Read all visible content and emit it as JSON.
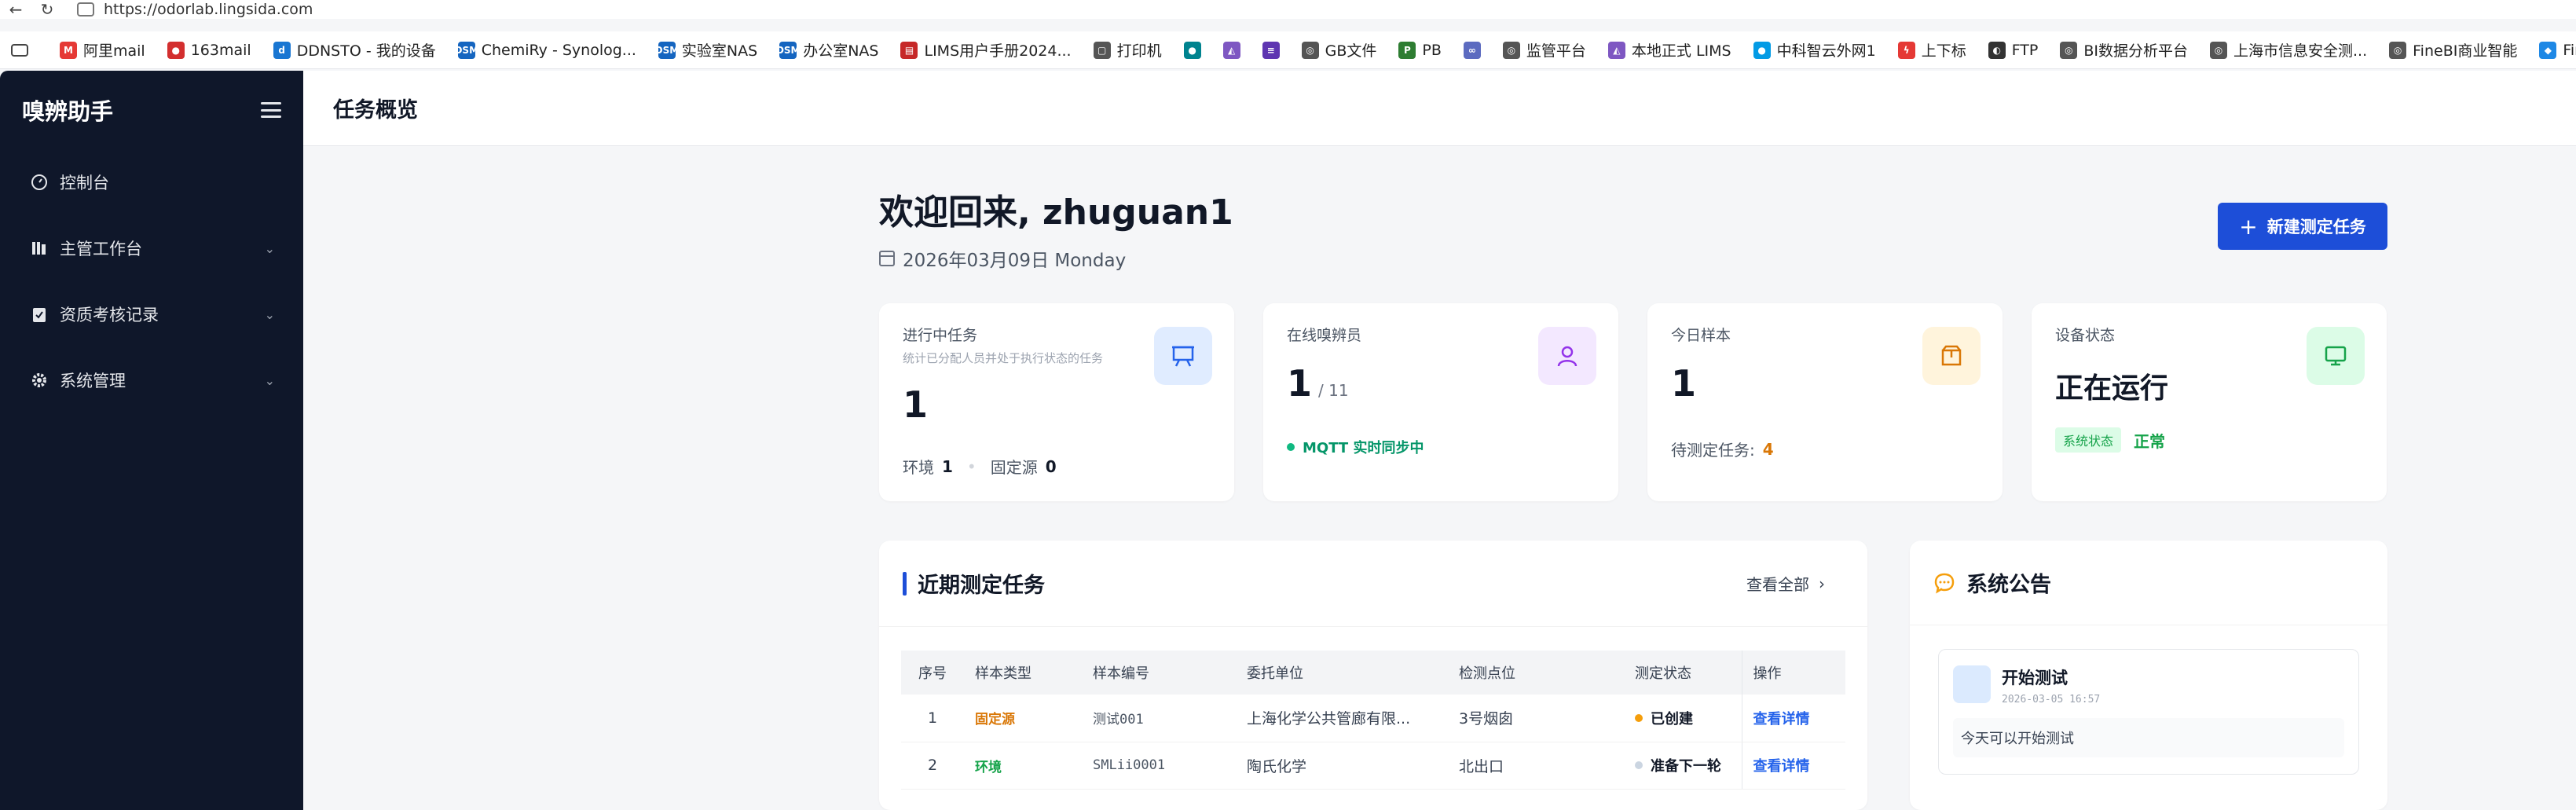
{
  "browser": {
    "url": "https://odorlab.lingsida.com",
    "bookmarks": [
      {
        "label": "阿里mail",
        "icon": "M",
        "color": "#e53935"
      },
      {
        "label": "163mail",
        "icon": "●",
        "color": "#d32f2f"
      },
      {
        "label": "DDNSTO - 我的设备",
        "icon": "d",
        "color": "#1976d2"
      },
      {
        "label": "ChemiRy - Synolog...",
        "icon": "DSM",
        "color": "#1565c0"
      },
      {
        "label": "实验室NAS",
        "icon": "DSM",
        "color": "#1565c0"
      },
      {
        "label": "办公室NAS",
        "icon": "DSM",
        "color": "#1565c0"
      },
      {
        "label": "LIMS用户手册2024...",
        "icon": "▤",
        "color": "#c62828"
      },
      {
        "label": "打印机",
        "icon": "▢",
        "color": "#555555"
      },
      {
        "label": "",
        "icon": "●",
        "color": "#00838f"
      },
      {
        "label": "",
        "icon": "◭",
        "color": "#7e57c2"
      },
      {
        "label": "",
        "icon": "≡",
        "color": "#5e35b1"
      },
      {
        "label": "GB文件",
        "icon": "◎",
        "color": "#555555"
      },
      {
        "label": "PB",
        "icon": "P",
        "color": "#2e7d32"
      },
      {
        "label": "",
        "icon": "∞",
        "color": "#5c6bc0"
      },
      {
        "label": "监管平台",
        "icon": "◎",
        "color": "#555555"
      },
      {
        "label": "本地正式 LIMS",
        "icon": "◭",
        "color": "#7e57c2"
      },
      {
        "label": "中科智云外网1",
        "icon": "●",
        "color": "#039be5"
      },
      {
        "label": "上下标",
        "icon": "ϟ",
        "color": "#e53935"
      },
      {
        "label": "FTP",
        "icon": "◐",
        "color": "#333333"
      },
      {
        "label": "BI数据分析平台",
        "icon": "◎",
        "color": "#555555"
      },
      {
        "label": "上海市信息安全测...",
        "icon": "◎",
        "color": "#555555"
      },
      {
        "label": "FineBI商业智能",
        "icon": "◎",
        "color": "#555555"
      },
      {
        "label": "Fin",
        "icon": "◆",
        "color": "#1e88e5"
      }
    ]
  },
  "sidebar": {
    "title": "嗅辨助手",
    "items": [
      {
        "label": "控制台",
        "icon": "dashboard-icon",
        "has_children": false
      },
      {
        "label": "主管工作台",
        "icon": "workbench-icon",
        "has_children": true
      },
      {
        "label": "资质考核记录",
        "icon": "clipboard-icon",
        "has_children": true
      },
      {
        "label": "系统管理",
        "icon": "gear-icon",
        "has_children": true
      }
    ]
  },
  "header": {
    "title": "任务概览"
  },
  "welcome": {
    "greeting": "欢迎回来, zhuguan1",
    "date": "2026年03月09日 Monday"
  },
  "new_task_button": "新建测定任务",
  "stats": {
    "in_progress": {
      "label": "进行中任务",
      "sub": "统计已分配人员并处于执行状态的任务",
      "value": "1",
      "env_label": "环境",
      "env_value": "1",
      "fixed_label": "固定源",
      "fixed_value": "0"
    },
    "online": {
      "label": "在线嗅辨员",
      "value": "1",
      "total": "/ 11",
      "sync_text": "MQTT 实时同步中"
    },
    "samples": {
      "label": "今日样本",
      "value": "1",
      "pending_label": "待测定任务:",
      "pending_value": "4"
    },
    "device": {
      "label": "设备状态",
      "value": "正在运行",
      "tag": "系统状态",
      "status": "正常"
    }
  },
  "recent_tasks": {
    "title": "近期测定任务",
    "view_all": "查看全部",
    "columns": [
      "序号",
      "样本类型",
      "样本编号",
      "委托单位",
      "检测点位",
      "测定状态",
      "操作"
    ],
    "rows": [
      {
        "index": "1",
        "type": "固定源",
        "type_color": "#d97706",
        "code": "测试001",
        "client": "上海化学公共管廊有限...",
        "point": "3号烟囱",
        "status": "已创建",
        "status_color": "#f59e0b",
        "action": "查看详情"
      },
      {
        "index": "2",
        "type": "环境",
        "type_color": "#16a34a",
        "code": "SMLii0001",
        "client": "陶氏化学",
        "point": "北出口",
        "status": "准备下一轮",
        "status_color": "#cbd5e1",
        "action": "查看详情"
      }
    ]
  },
  "announcements": {
    "title": "系统公告",
    "items": [
      {
        "title": "开始测试",
        "time": "2026-03-05 16:57",
        "body": "今天可以开始测试"
      }
    ]
  }
}
